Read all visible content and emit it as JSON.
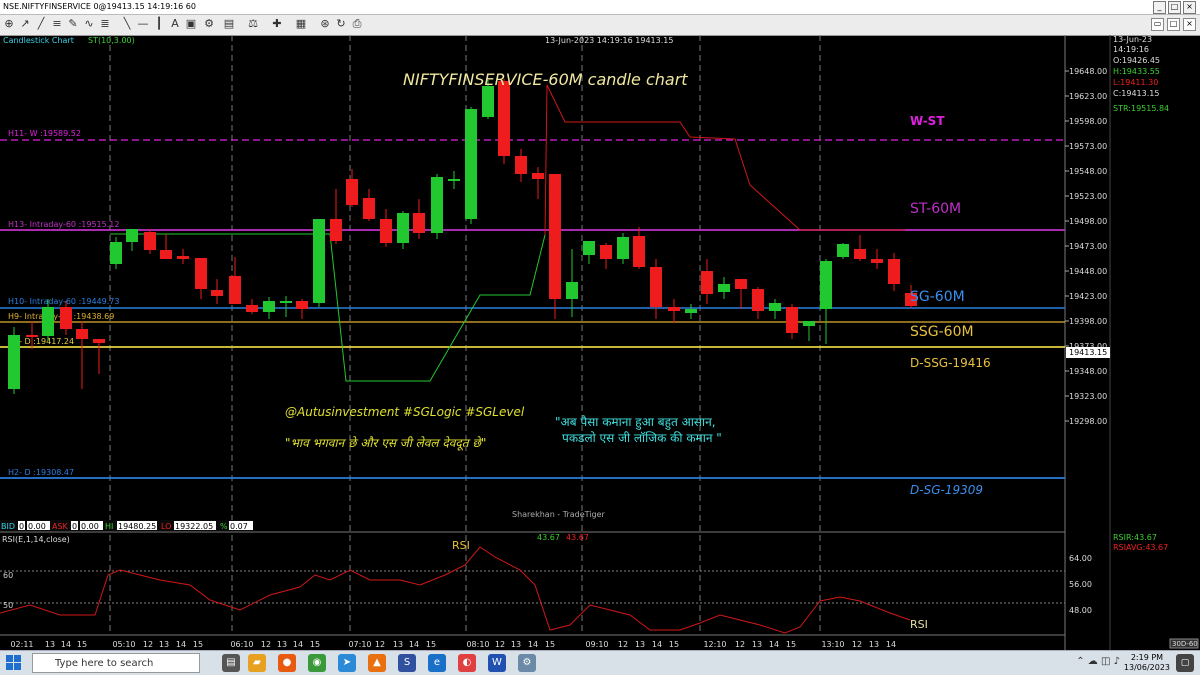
{
  "window": {
    "title": "NSE.NIFTYFINSERVICE 0@19413.15 14:19:16 60"
  },
  "chart_header": {
    "label": "Candlestick Chart",
    "indicator": "ST(10,3.00)",
    "datetime_center": "13-Jun-2023 14:19:16 19413.15"
  },
  "chart_title": "NIFTYFINSERVICE-60M candle chart",
  "info_panel": {
    "date": "13-Jun-23",
    "time": "14:19:16",
    "open": "O:19426.45",
    "high": "H:19433.55",
    "low": "L:19411.30",
    "close": "C:19413.15",
    "st": "STR:19515.84"
  },
  "price_axis": [
    "19648.00",
    "19623.00",
    "19598.00",
    "19573.00",
    "19548.00",
    "19523.00",
    "19498.00",
    "19473.00",
    "19448.00",
    "19423.00",
    "19398.00",
    "19373.00",
    "19348.00",
    "19323.00",
    "19298.00"
  ],
  "current_price_tag": "19413.15",
  "levels": [
    {
      "label": "H11- W :19589.52",
      "color": "#e020e0"
    },
    {
      "label": "H13- Intraday-60 :19515.12",
      "color": "#c030c8"
    },
    {
      "label": "H10- Intraday-60 :19449.73",
      "color": "#2a7fe0"
    },
    {
      "label": "H9- Intraday-60 :19438.69",
      "color": "#e0b030"
    },
    {
      "label": "H1- D :19417.24",
      "color": "#e0d040"
    },
    {
      "label": "H2- D :19308.47",
      "color": "#2a7fe0"
    }
  ],
  "annotations": {
    "w_st": "W-ST",
    "st_60m": "ST-60M",
    "sg_60m": "SG-60M",
    "ssg_60m": "SSG-60M",
    "d_ssg": "D-SSG-19416",
    "d_sg": "D-SG-19309",
    "handle": "@Autusinvestment  #SGLogic  #SGLevel",
    "hindi_left": "\"भाव भगवान छे और एस जी लेवल देवदूत छे\"",
    "hindi_right_1": "\"अब पैसा कमाना हुआ बहुत आसान,",
    "hindi_right_2": "पकडलो एस जी लॉजिक की कमान \""
  },
  "watermark": "Sharekhan - TradeTiger",
  "quote_bar": {
    "bid_label": "BID",
    "bid_qty": "0",
    "bid": "0.00",
    "ask_label": "ASK",
    "ask_qty": "0",
    "ask": "0.00",
    "hi_label": "HI",
    "hi": "19480.25",
    "lo_label": "LO",
    "lo": "19322.05",
    "pct_label": "%",
    "pct": "0.07"
  },
  "rsi": {
    "header": "RSI(E,1,14,close)",
    "label_top": "RSI",
    "label_bottom": "RSI",
    "values_a": "43.67",
    "values_b": "43.67",
    "rsir": "RSIR:43.67",
    "rsiavg": "RSIAVG:43.67",
    "axis": [
      "64.00",
      "56.00",
      "48.00"
    ],
    "left_levels": [
      "60",
      "50"
    ]
  },
  "time_axis": [
    "02:11",
    "13",
    "14",
    "15",
    "05:10",
    "12",
    "13",
    "14",
    "15",
    "06:10",
    "12",
    "13",
    "14",
    "15",
    "07:10",
    "12",
    "13",
    "14",
    "15",
    "08:10",
    "12",
    "13",
    "14",
    "15",
    "09:10",
    "12",
    "13",
    "14",
    "15",
    "12:10",
    "12",
    "13",
    "14",
    "15",
    "13:10",
    "12",
    "13",
    "14"
  ],
  "corner_label": "30D-60",
  "colors": {
    "up": "#22c830",
    "down": "#ee1c1c",
    "supertrend_up": "#22c830",
    "supertrend_down": "#d01818",
    "rsi_line": "#d01818"
  },
  "taskbar": {
    "search_placeholder": "Type here to search",
    "time": "2:19 PM",
    "date": "13/06/2023"
  }
}
